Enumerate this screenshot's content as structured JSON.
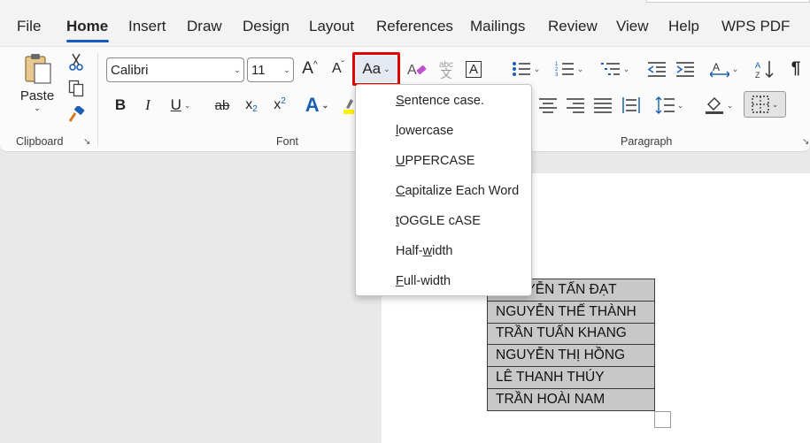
{
  "tabs": [
    "File",
    "Home",
    "Insert",
    "Draw",
    "Design",
    "Layout",
    "References",
    "Mailings",
    "Review",
    "View",
    "Help",
    "WPS PDF"
  ],
  "active_tab": "Home",
  "clipboard": {
    "paste_label": "Paste",
    "group_label": "Clipboard"
  },
  "font": {
    "name": "Calibri",
    "size": "11",
    "group_label": "Font",
    "change_case_label": "Aa",
    "clear_format_label": "abc",
    "char_border_label": "A",
    "bold": "B",
    "italic": "I",
    "underline": "U",
    "strike": "ab",
    "subscript": "x",
    "subscript_mark": "2",
    "superscript": "x",
    "superscript_mark": "2",
    "text_effects": "A",
    "grow": "A",
    "shrink": "A"
  },
  "paragraph": {
    "group_label": "Paragraph",
    "pilcrow": "¶"
  },
  "change_case_menu": {
    "items": [
      {
        "prefix": "",
        "key": "S",
        "rest": "entence case."
      },
      {
        "prefix": "",
        "key": "l",
        "rest": "owercase"
      },
      {
        "prefix": "",
        "key": "U",
        "rest": "PPERCASE"
      },
      {
        "prefix": "",
        "key": "C",
        "rest": "apitalize Each Word"
      },
      {
        "prefix": "",
        "key": "t",
        "rest": "OGGLE cASE"
      },
      {
        "prefix": "Half-",
        "key": "w",
        "rest": "idth"
      },
      {
        "prefix": "",
        "key": "F",
        "rest": "ull-width"
      }
    ]
  },
  "table": {
    "rows": [
      "NGUYỄN TẤN ĐẠT",
      "NGUYỄN THẾ THÀNH",
      "TRẦN TUẤN KHANG",
      "NGUYỄN THỊ HỒNG",
      "LÊ THANH THÚY",
      "TRẦN HOÀI NAM"
    ]
  },
  "colors": {
    "accent": "#185abd",
    "highlight_border": "#e00000",
    "selection": "#c8c8c8"
  },
  "icons": [
    "paste-icon",
    "cut-icon",
    "copy-icon",
    "format-painter-icon",
    "grow-font-icon",
    "shrink-font-icon",
    "change-case-icon",
    "clear-formatting-icon",
    "phonetic-guide-icon",
    "character-border-icon",
    "bullets-icon",
    "numbering-icon",
    "multilevel-list-icon",
    "decrease-indent-icon",
    "increase-indent-icon",
    "text-direction-icon",
    "sort-icon",
    "show-marks-icon",
    "align-center-icon",
    "align-right-icon",
    "justify-icon",
    "distributed-icon",
    "line-spacing-icon",
    "shading-icon",
    "borders-icon",
    "text-effects-icon",
    "highlight-icon"
  ]
}
